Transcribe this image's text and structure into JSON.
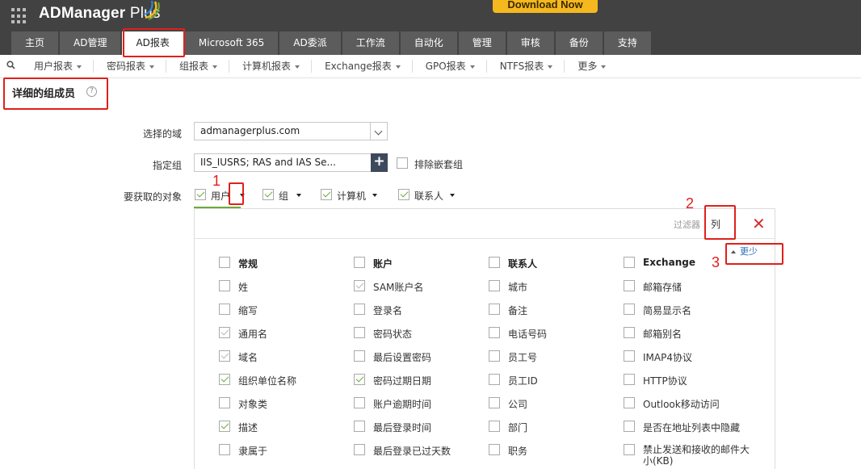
{
  "header": {
    "logo_text": "ADManager",
    "logo_plus": " Plus",
    "download_label": "Download Now"
  },
  "tabs": [
    "主页",
    "AD管理",
    "AD报表",
    "Microsoft 365",
    "AD委派",
    "工作流",
    "自动化",
    "管理",
    "审核",
    "备份",
    "支持"
  ],
  "active_tab": "AD报表",
  "subnav": [
    "用户报表",
    "密码报表",
    "组报表",
    "计算机报表",
    "Exchange报表",
    "GPO报表",
    "NTFS报表",
    "更多"
  ],
  "page": {
    "title": "详细的组成员"
  },
  "form": {
    "domain_label": "选择的域",
    "domain_value": "admanagerplus.com",
    "group_label": "指定组",
    "group_value": "IIS_IUSRS; RAS and IAS Se...",
    "exclude_nested_label": "排除嵌套组",
    "objects_label": "要获取的对象",
    "objects": [
      {
        "label": "用户",
        "checked": true
      },
      {
        "label": "组",
        "checked": true
      },
      {
        "label": "计算机",
        "checked": true
      },
      {
        "label": "联系人",
        "checked": true
      }
    ]
  },
  "panel": {
    "filter_label": "过滤器",
    "filter_value": "列",
    "less_label": "更少",
    "columns": [
      {
        "heading": "常规",
        "items": [
          {
            "label": "姓",
            "state": "unchecked"
          },
          {
            "label": "缩写",
            "state": "unchecked"
          },
          {
            "label": "通用名",
            "state": "disabled"
          },
          {
            "label": "域名",
            "state": "disabled"
          },
          {
            "label": "组织单位名称",
            "state": "checked"
          },
          {
            "label": "对象类",
            "state": "unchecked"
          },
          {
            "label": "描述",
            "state": "checked"
          },
          {
            "label": "隶属于",
            "state": "unchecked"
          }
        ]
      },
      {
        "heading": "账户",
        "items": [
          {
            "label": "SAM账户名",
            "state": "disabled"
          },
          {
            "label": "登录名",
            "state": "unchecked"
          },
          {
            "label": "密码状态",
            "state": "unchecked"
          },
          {
            "label": "最后设置密码",
            "state": "unchecked"
          },
          {
            "label": "密码过期日期",
            "state": "checked"
          },
          {
            "label": "账户逾期时间",
            "state": "unchecked"
          },
          {
            "label": "最后登录时间",
            "state": "unchecked"
          },
          {
            "label": "最后登录已过天数",
            "state": "unchecked"
          }
        ]
      },
      {
        "heading": "联系人",
        "items": [
          {
            "label": "城市",
            "state": "unchecked"
          },
          {
            "label": "备注",
            "state": "unchecked"
          },
          {
            "label": "电话号码",
            "state": "unchecked"
          },
          {
            "label": "员工号",
            "state": "unchecked"
          },
          {
            "label": "员工ID",
            "state": "unchecked"
          },
          {
            "label": "公司",
            "state": "unchecked"
          },
          {
            "label": "部门",
            "state": "unchecked"
          },
          {
            "label": "职务",
            "state": "unchecked"
          }
        ]
      },
      {
        "heading": "Exchange",
        "items": [
          {
            "label": "邮箱存储",
            "state": "unchecked"
          },
          {
            "label": "简易显示名",
            "state": "unchecked"
          },
          {
            "label": "邮箱别名",
            "state": "unchecked"
          },
          {
            "label": "IMAP4协议",
            "state": "unchecked"
          },
          {
            "label": "HTTP协议",
            "state": "unchecked"
          },
          {
            "label": "Outlook移动访问",
            "state": "unchecked"
          },
          {
            "label": "是否在地址列表中隐藏",
            "state": "unchecked"
          },
          {
            "label": "禁止发送和接收的邮件大",
            "label2": "小(KB)",
            "state": "unchecked"
          }
        ]
      }
    ]
  },
  "annotations": [
    "1",
    "2",
    "3"
  ],
  "colors": {
    "header_bg": "#424242",
    "tab_bg": "#5c5c5c",
    "download_bg": "#f5b81f",
    "check_green": "#6aab3a",
    "annotation_red": "#e0201b",
    "link_blue": "#2a6fb5"
  }
}
